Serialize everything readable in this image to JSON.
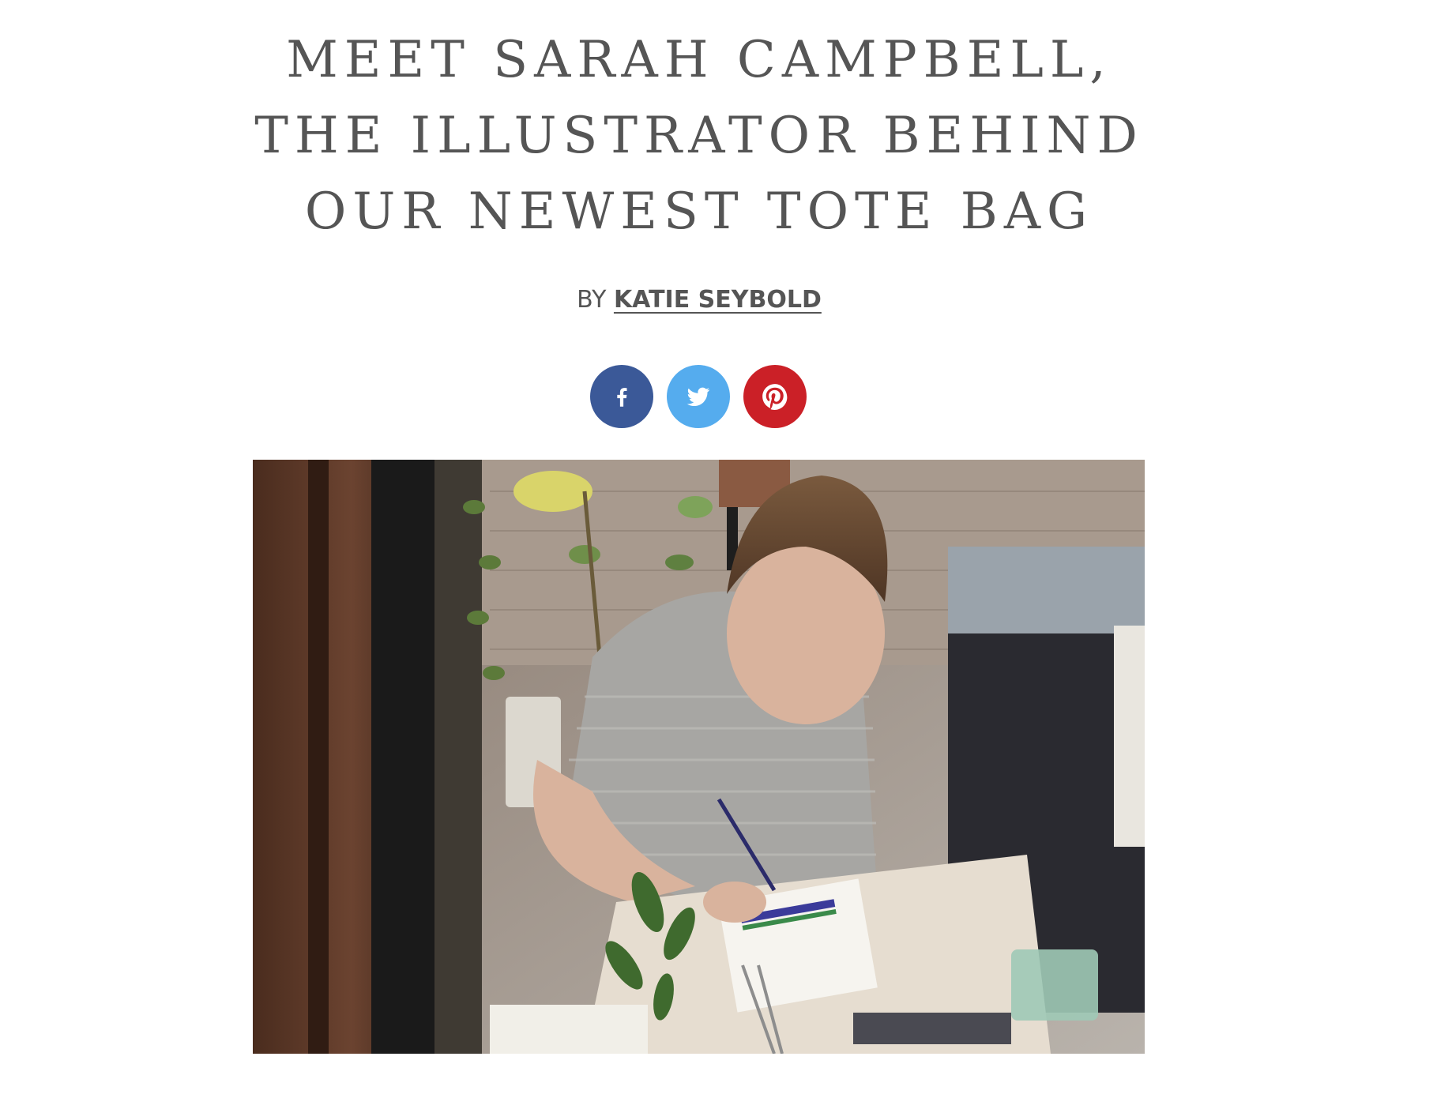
{
  "article": {
    "title": "MEET SARAH CAMPBELL, THE ILLUSTRATOR BEHIND OUR NEWEST TOTE BAG",
    "byline_prefix": "BY",
    "author": "KATIE SEYBOLD"
  },
  "share": {
    "buttons": [
      {
        "network": "facebook",
        "icon": "facebook-icon",
        "color": "#3b5998"
      },
      {
        "network": "twitter",
        "icon": "twitter-icon",
        "color": "#55acee"
      },
      {
        "network": "pinterest",
        "icon": "pinterest-icon",
        "color": "#cb2027"
      }
    ]
  },
  "colors": {
    "text": "#555555",
    "background": "#ffffff"
  }
}
